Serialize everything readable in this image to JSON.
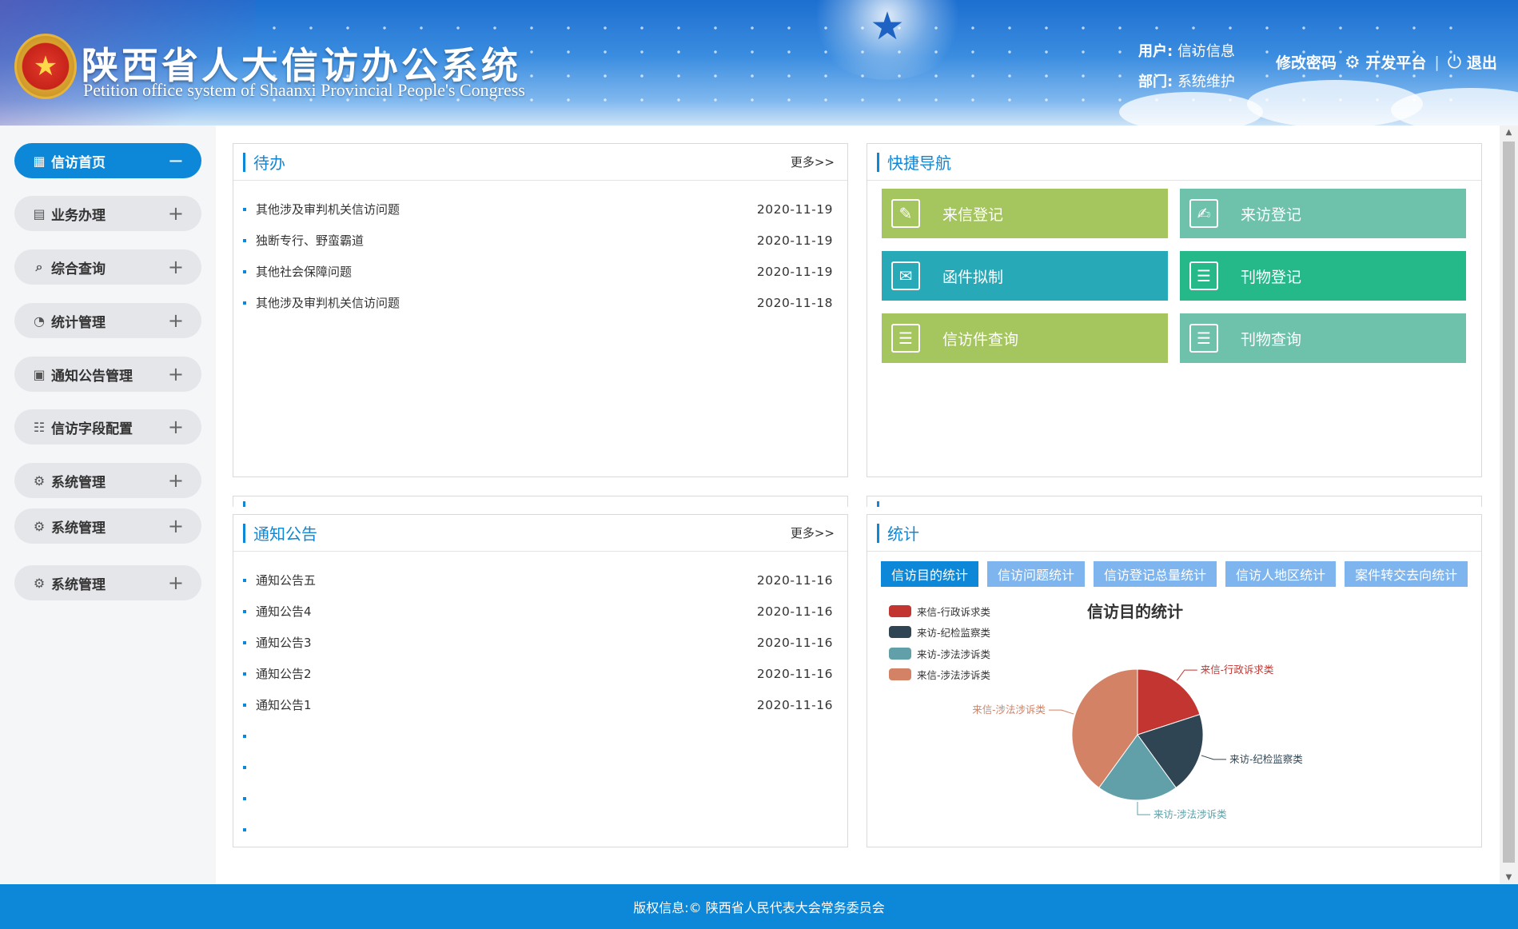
{
  "header": {
    "title": "陕西省人大信访办公系统",
    "subtitle": "Petition office system of Shaanxi Provincial People's Congress",
    "user_label": "用户:",
    "user_value": "信访信息",
    "dept_label": "部门:",
    "dept_value": "系统维护",
    "change_password": "修改密码",
    "dev_platform": "开发平台",
    "logout": "退出",
    "separator": "|"
  },
  "sidebar": {
    "items": [
      {
        "label": "信访首页",
        "icon": "grid-icon",
        "toggle": "−"
      },
      {
        "label": "业务办理",
        "icon": "document-icon",
        "toggle": "+"
      },
      {
        "label": "综合查询",
        "icon": "search-icon",
        "toggle": "+"
      },
      {
        "label": "统计管理",
        "icon": "pie-icon",
        "toggle": "+"
      },
      {
        "label": "通知公告管理",
        "icon": "notice-icon",
        "toggle": "+"
      },
      {
        "label": "信访字段配置",
        "icon": "fields-icon",
        "toggle": "+"
      },
      {
        "label": "系统管理",
        "icon": "gear-icon",
        "toggle": "+"
      },
      {
        "label": "系统管理",
        "icon": "gear-icon",
        "toggle": "+"
      },
      {
        "label": "系统管理",
        "icon": "gear-icon",
        "toggle": "+"
      }
    ]
  },
  "todo": {
    "title": "待办",
    "more": "更多>>",
    "items": [
      {
        "text": "其他涉及审判机关信访问题",
        "date": "2020-11-19"
      },
      {
        "text": "独断专行、野蛮霸道",
        "date": "2020-11-19"
      },
      {
        "text": "其他社会保障问题",
        "date": "2020-11-19"
      },
      {
        "text": "其他涉及审判机关信访问题",
        "date": "2020-11-18"
      }
    ]
  },
  "quicknav": {
    "title": "快捷导航",
    "buttons": [
      {
        "label": "来信登记",
        "color": "#a5c55e",
        "icon": "letter-register-icon"
      },
      {
        "label": "来访登记",
        "color": "#6ec1ab",
        "icon": "visit-register-icon"
      },
      {
        "label": "函件拟制",
        "color": "#27a9b8",
        "icon": "envelope-icon"
      },
      {
        "label": "刊物登记",
        "color": "#25b98a",
        "icon": "publication-register-icon"
      },
      {
        "label": "信访件查询",
        "color": "#a5c55e",
        "icon": "petition-query-icon"
      },
      {
        "label": "刊物查询",
        "color": "#6ec1ab",
        "icon": "publication-query-icon"
      }
    ]
  },
  "notice": {
    "title": "通知公告",
    "more": "更多>>",
    "items": [
      {
        "text": "通知公告五",
        "date": "2020-11-16"
      },
      {
        "text": "通知公告4",
        "date": "2020-11-16"
      },
      {
        "text": "通知公告3",
        "date": "2020-11-16"
      },
      {
        "text": "通知公告2",
        "date": "2020-11-16"
      },
      {
        "text": "通知公告1",
        "date": "2020-11-16"
      },
      {
        "text": "",
        "date": ""
      },
      {
        "text": "",
        "date": ""
      },
      {
        "text": "",
        "date": ""
      },
      {
        "text": "",
        "date": ""
      }
    ]
  },
  "stats": {
    "title": "统计",
    "tabs": [
      "信访目的统计",
      "信访问题统计",
      "信访登记总量统计",
      "信访人地区统计",
      "案件转交去向统计"
    ],
    "active_tab": 0
  },
  "chart_data": {
    "type": "pie",
    "title": "信访目的统计",
    "legend_position": "top-left",
    "categories": [
      "来信-行政诉求类",
      "来访-纪检监察类",
      "来访-涉法涉诉类",
      "来信-涉法涉诉类"
    ],
    "values": [
      20,
      20,
      20,
      40
    ],
    "colors": [
      "#c23531",
      "#2f4554",
      "#61a0a8",
      "#d48265"
    ]
  },
  "footer": {
    "text": "版权信息:© 陕西省人民代表大会常务委员会"
  },
  "colors": {
    "accent": "#0d87d7",
    "tab_inactive": "#7eb5ee"
  }
}
